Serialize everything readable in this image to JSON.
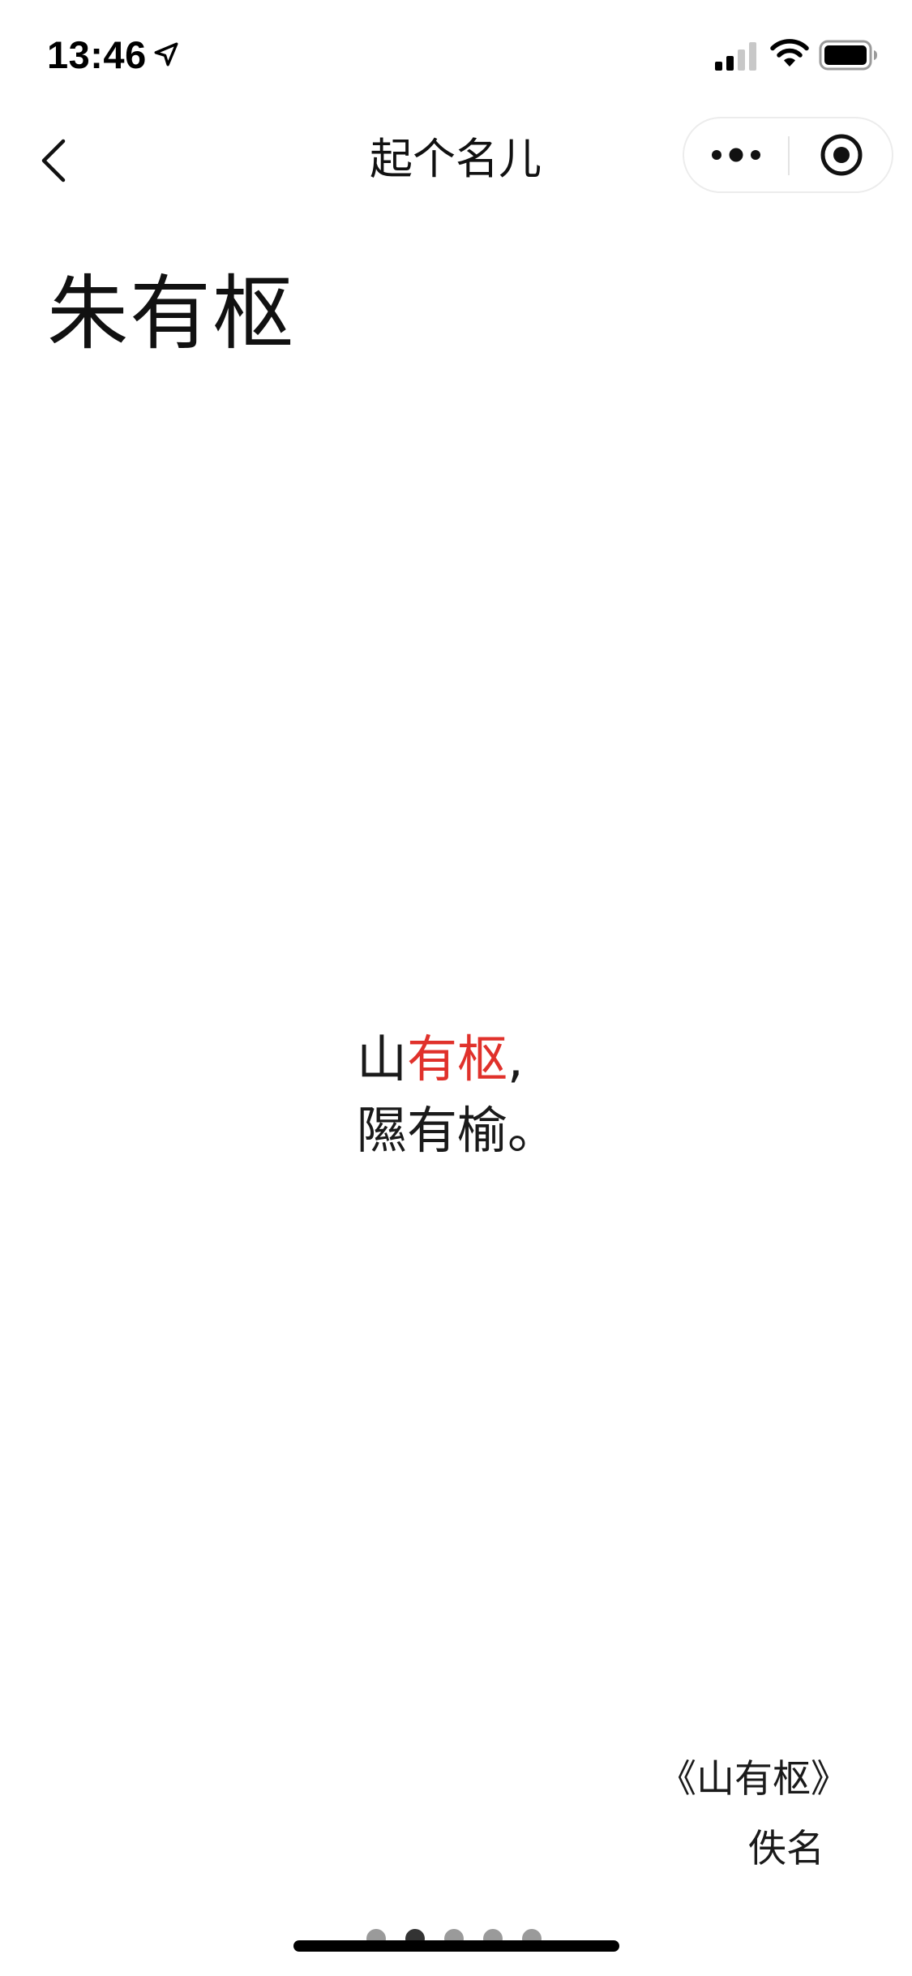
{
  "status_bar": {
    "time": "13:46",
    "icons": [
      "location-arrow-icon",
      "cellular-signal-icon",
      "wifi-icon",
      "battery-icon"
    ]
  },
  "nav": {
    "title": "起个名儿",
    "back_icon": "chevron-left-icon",
    "more_icon": "more-dots-icon",
    "close_icon": "target-circle-icon"
  },
  "name": "朱有枢",
  "poem": {
    "line1_prefix": "山",
    "line1_highlight": "有枢",
    "line1_suffix": ",",
    "line2": "隰有榆。"
  },
  "source": {
    "title": "《山有枢》",
    "author": "佚名"
  },
  "pager": {
    "count": 5,
    "active_index": 1
  },
  "colors": {
    "highlight": "#e0312b",
    "text": "#111111",
    "dot_inactive": "#9a9a9a",
    "dot_active": "#333333"
  }
}
